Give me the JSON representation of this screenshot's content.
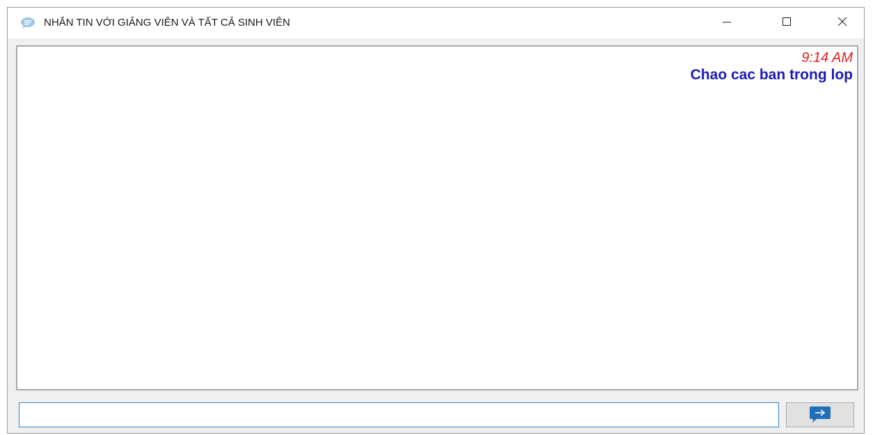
{
  "window": {
    "title": "NHẮN TIN VỚI GIẢNG VIÊN VÀ TẤT CẢ SINH VIÊN",
    "icon": "chat-bubble-icon",
    "controls": [
      "minimize-icon",
      "maximize-icon",
      "close-icon"
    ]
  },
  "chat": {
    "messages": [
      {
        "time": "9:14 AM",
        "text": "Chao cac ban trong lop"
      }
    ]
  },
  "composer": {
    "input_value": "",
    "send_icon": "send-arrow-icon"
  },
  "colors": {
    "time": "#e0201f",
    "message": "#1a1ab8",
    "input_border": "#3a82c8",
    "send_icon": "#1f6fb8"
  }
}
